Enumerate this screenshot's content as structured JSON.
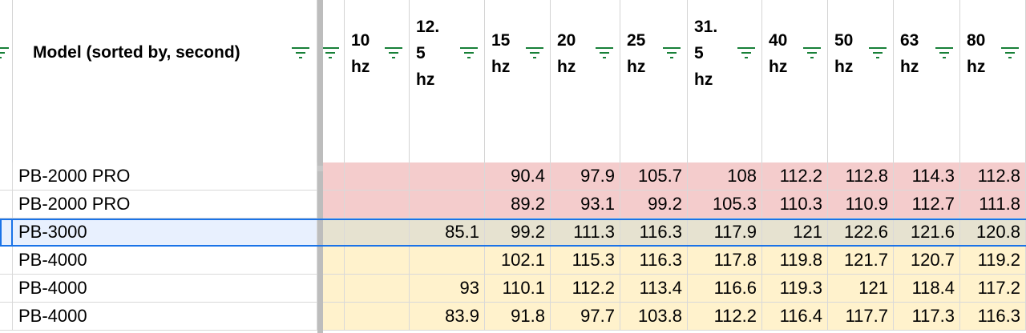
{
  "header": {
    "model_label": "Model (sorted by, second)",
    "freq_labels": [
      "10\nhz",
      "12.\n5\nhz",
      "15\nhz",
      "20\nhz",
      "25\nhz",
      "31.\n5\nhz",
      "40\nhz",
      "50\nhz",
      "63\nhz",
      "80\nhz"
    ]
  },
  "colors": {
    "red_band": "#f4cccc",
    "gray_band": "#e6e2d0",
    "yellow_band": "#fff2cc",
    "selected_name_bg": "#e8f0fe",
    "filter_icon": "#188038",
    "selection": "#1a73e8"
  },
  "rows": [
    {
      "model": "PB-2000 PRO",
      "band": "red",
      "values": [
        "",
        "",
        "90.4",
        "97.9",
        "105.7",
        "108",
        "112.2",
        "112.8",
        "114.3",
        "112.8"
      ]
    },
    {
      "model": "PB-2000 PRO",
      "band": "red",
      "values": [
        "",
        "",
        "89.2",
        "93.1",
        "99.2",
        "105.3",
        "110.3",
        "110.9",
        "112.7",
        "111.8"
      ]
    },
    {
      "model": "PB-3000",
      "band": "gray",
      "selected": true,
      "values": [
        "",
        "85.1",
        "99.2",
        "111.3",
        "116.3",
        "117.9",
        "121",
        "122.6",
        "121.6",
        "120.8"
      ]
    },
    {
      "model": "PB-4000",
      "band": "yellow",
      "values": [
        "",
        "",
        "102.1",
        "115.3",
        "116.3",
        "117.8",
        "119.8",
        "121.7",
        "120.7",
        "119.2"
      ]
    },
    {
      "model": "PB-4000",
      "band": "yellow",
      "values": [
        "",
        "93",
        "110.1",
        "112.2",
        "113.4",
        "116.6",
        "119.3",
        "121",
        "118.4",
        "117.2"
      ]
    },
    {
      "model": "PB-4000",
      "band": "yellow",
      "values": [
        "",
        "83.9",
        "91.8",
        "97.7",
        "103.8",
        "112.2",
        "116.4",
        "117.7",
        "117.3",
        "116.3"
      ]
    }
  ]
}
